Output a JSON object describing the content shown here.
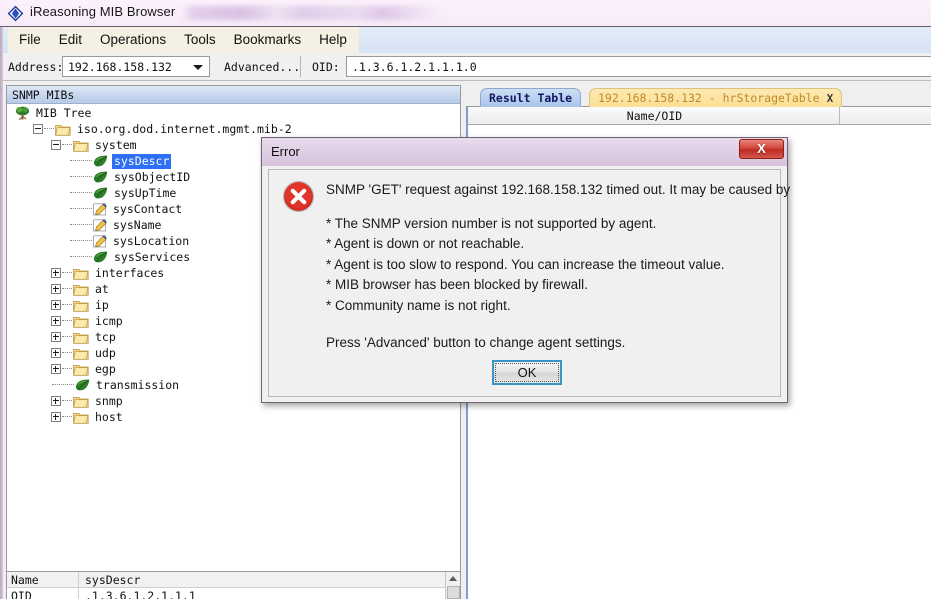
{
  "window": {
    "title": "iReasoning MIB Browser",
    "icon": "diamond-app-icon"
  },
  "menubar": {
    "items": [
      {
        "label": "File"
      },
      {
        "label": "Edit"
      },
      {
        "label": "Operations"
      },
      {
        "label": "Tools"
      },
      {
        "label": "Bookmarks"
      },
      {
        "label": "Help"
      }
    ]
  },
  "toolbar": {
    "address_label": "Address:",
    "address_value": "192.168.158.132",
    "advanced_label": "Advanced...",
    "oid_label": "OID:",
    "oid_value": ".1.3.6.1.2.1.1.1.0"
  },
  "left_panel": {
    "header": "SNMP MIBs",
    "tree": [
      {
        "label": "MIB Tree",
        "depth": 0,
        "icon": "tree-icon",
        "expander": "none",
        "selected": false
      },
      {
        "label": "iso.org.dod.internet.mgmt.mib-2",
        "depth": 1,
        "icon": "folder-icon",
        "expander": "minus",
        "selected": false
      },
      {
        "label": "system",
        "depth": 2,
        "icon": "folder-icon",
        "expander": "minus",
        "selected": false
      },
      {
        "label": "sysDescr",
        "depth": 3,
        "icon": "leaf-icon",
        "expander": "none-dot",
        "selected": true
      },
      {
        "label": "sysObjectID",
        "depth": 3,
        "icon": "leaf-icon",
        "expander": "none-dot",
        "selected": false
      },
      {
        "label": "sysUpTime",
        "depth": 3,
        "icon": "leaf-icon",
        "expander": "none-dot",
        "selected": false
      },
      {
        "label": "sysContact",
        "depth": 3,
        "icon": "pen-icon",
        "expander": "none-dot",
        "selected": false
      },
      {
        "label": "sysName",
        "depth": 3,
        "icon": "pen-icon",
        "expander": "none-dot",
        "selected": false
      },
      {
        "label": "sysLocation",
        "depth": 3,
        "icon": "pen-icon",
        "expander": "none-dot",
        "selected": false
      },
      {
        "label": "sysServices",
        "depth": 3,
        "icon": "leaf-icon",
        "expander": "none-dot",
        "selected": false
      },
      {
        "label": "interfaces",
        "depth": 2,
        "icon": "folder-icon",
        "expander": "plus",
        "selected": false
      },
      {
        "label": "at",
        "depth": 2,
        "icon": "folder-icon",
        "expander": "plus",
        "selected": false
      },
      {
        "label": "ip",
        "depth": 2,
        "icon": "folder-icon",
        "expander": "plus",
        "selected": false
      },
      {
        "label": "icmp",
        "depth": 2,
        "icon": "folder-icon",
        "expander": "plus",
        "selected": false
      },
      {
        "label": "tcp",
        "depth": 2,
        "icon": "folder-icon",
        "expander": "plus",
        "selected": false
      },
      {
        "label": "udp",
        "depth": 2,
        "icon": "folder-icon",
        "expander": "plus",
        "selected": false
      },
      {
        "label": "egp",
        "depth": 2,
        "icon": "folder-icon",
        "expander": "plus",
        "selected": false
      },
      {
        "label": "transmission",
        "depth": 2,
        "icon": "leaf-icon",
        "expander": "none-dot",
        "selected": false
      },
      {
        "label": "snmp",
        "depth": 2,
        "icon": "folder-icon",
        "expander": "plus",
        "selected": false
      },
      {
        "label": "host",
        "depth": 2,
        "icon": "folder-icon",
        "expander": "plus",
        "selected": false
      }
    ]
  },
  "properties": {
    "rows": [
      {
        "key": "Name",
        "value": "sysDescr"
      },
      {
        "key": "OID",
        "value": ".1.3.6.1.2.1.1.1"
      }
    ]
  },
  "right_panel": {
    "tabs": [
      {
        "label": "Result Table",
        "active": true,
        "closable": false,
        "close_label": ""
      },
      {
        "label": "192.168.158.132 - hrStorageTable",
        "active": false,
        "closable": true,
        "close_label": "X"
      }
    ],
    "table": {
      "columns": [
        "Name/OID",
        ""
      ],
      "rows": []
    }
  },
  "dialog": {
    "title": "Error",
    "close_label": "X",
    "icon": "error-circle-icon",
    "headline": "SNMP 'GET' request against 192.168.158.132 timed out. It may be caused by",
    "causes": [
      "* The SNMP version number is not supported by agent.",
      "* Agent is down or not reachable.",
      "* Agent is too slow to respond. You can increase the timeout value.",
      "* MIB browser has been blocked by firewall.",
      "* Community name is not right."
    ],
    "footer": "Press 'Advanced' button to change agent settings.",
    "ok_label": "OK"
  },
  "colors": {
    "title_bar": "#faeefa",
    "selection_blue": "#2d6ff5",
    "tab_active": "#a8c4ea",
    "tab_second": "#fbdf95",
    "error_red": "#cc2018",
    "dialog_title": "#ddcbe2"
  }
}
